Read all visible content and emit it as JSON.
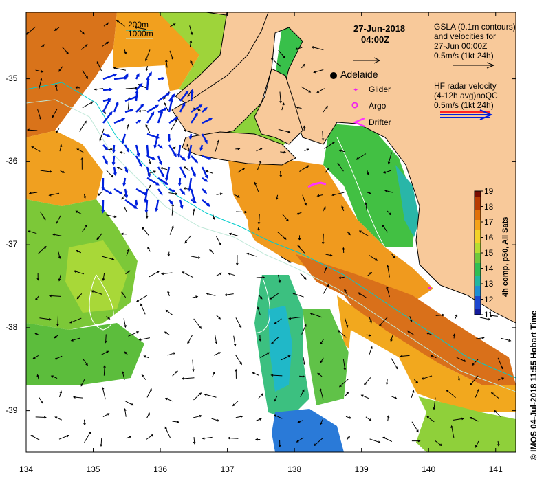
{
  "map": {
    "lon_range": [
      134,
      141.3
    ],
    "lat_range": [
      -39.5,
      -34.2
    ],
    "lon_ticks": [
      "134",
      "135",
      "136",
      "137",
      "138",
      "139",
      "140",
      "141"
    ],
    "lat_ticks": [
      "-35",
      "-36",
      "-37",
      "-38",
      "-39"
    ]
  },
  "legend": {
    "isobath_200": "200m",
    "isobath_1000": "1000m",
    "date": "27-Jun-2018",
    "time": "04:00Z",
    "gsla_line1": "GSLA (0.1m contours)",
    "gsla_line2": "and velocities for",
    "gsla_line3": "27-Jun 00:00Z",
    "gsla_line4": "0.5m/s (1kt 24h)",
    "hf_line1": "HF radar velocity",
    "hf_line2": "(4-12h avg)noQC",
    "hf_line3": "0.5m/s (1kt 24h)",
    "adelaide": "Adelaide",
    "glider": "Glider",
    "argo": "Argo",
    "drifter": "Drifter"
  },
  "colorbar": {
    "title": "4h comp, p50, All Sats",
    "ticks": [
      "19",
      "18",
      "17",
      "16",
      "15",
      "14",
      "13",
      "12",
      "11"
    ],
    "min": 11,
    "max": 19
  },
  "credit": "© IMOS 04-Jul-2018 11:55 Hobart Time",
  "colors": {
    "land": "#f8c99a",
    "isobath_200": "#00cccc",
    "isobath_1000": "#aaddcc",
    "hf_radar": "#0020dd",
    "drifter": "#ff33ff",
    "glider": "#ee22ee"
  }
}
